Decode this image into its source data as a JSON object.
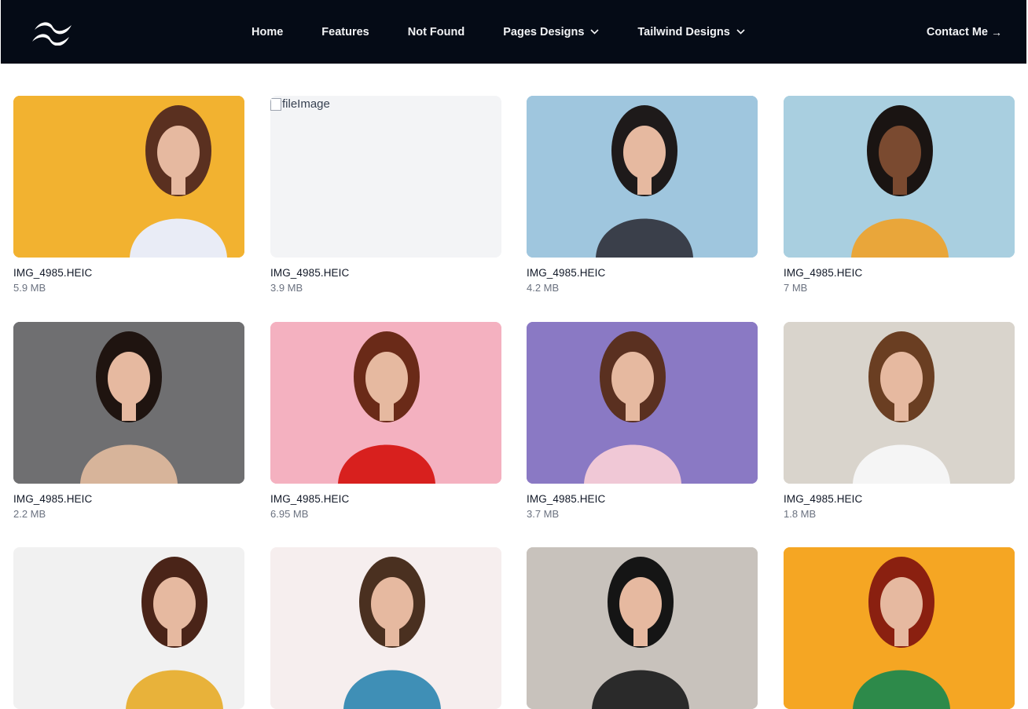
{
  "navbar": {
    "logo_icon": "tailwind-logo-icon",
    "links": [
      {
        "label": "Home",
        "dropdown": false
      },
      {
        "label": "Features",
        "dropdown": false
      },
      {
        "label": "Not Found",
        "dropdown": false
      },
      {
        "label": "Pages Designs",
        "dropdown": true
      },
      {
        "label": "Tailwind Designs",
        "dropdown": true
      }
    ],
    "contact_label": "Contact Me",
    "contact_arrow": "→",
    "background_color": "#050b16"
  },
  "files": [
    {
      "name": "IMG_4985.HEIC",
      "size": "5.9 MB",
      "image": "woman-pointing-yellow-background",
      "bg": "#f2b230"
    },
    {
      "name": "IMG_4985.HEIC",
      "size": "3.9 MB",
      "image": "broken-image",
      "alt": "fileImage",
      "bg": "#f3f4f6"
    },
    {
      "name": "IMG_4985.HEIC",
      "size": "4.2 MB",
      "image": "woman-plaid-shirt-blue-background",
      "bg": "#9fc6de"
    },
    {
      "name": "IMG_4985.HEIC",
      "size": "7 MB",
      "image": "woman-curly-hair-sunglasses",
      "bg": "#a9cfe0"
    },
    {
      "name": "IMG_4985.HEIC",
      "size": "2.2 MB",
      "image": "woman-long-hair-gray-background",
      "bg": "#6f6f71"
    },
    {
      "name": "IMG_4985.HEIC",
      "size": "6.95 MB",
      "image": "woman-red-coat-pink-background",
      "bg": "#f4b1c0"
    },
    {
      "name": "IMG_4985.HEIC",
      "size": "3.7 MB",
      "image": "woman-chair-purple-background",
      "bg": "#8a79c4"
    },
    {
      "name": "IMG_4985.HEIC",
      "size": "1.8 MB",
      "image": "woman-street-white-outfit",
      "bg": "#d9d4cc"
    },
    {
      "name": "",
      "size": "",
      "image": "woman-pointing-white-background",
      "bg": "#f1f1f1"
    },
    {
      "name": "",
      "size": "",
      "image": "man-denim-jacket",
      "bg": "#f6eeee"
    },
    {
      "name": "",
      "size": "",
      "image": "woman-black-hat-street",
      "bg": "#c8c2bc"
    },
    {
      "name": "",
      "size": "",
      "image": "woman-red-hair-orange-background",
      "bg": "#f5a623"
    }
  ]
}
